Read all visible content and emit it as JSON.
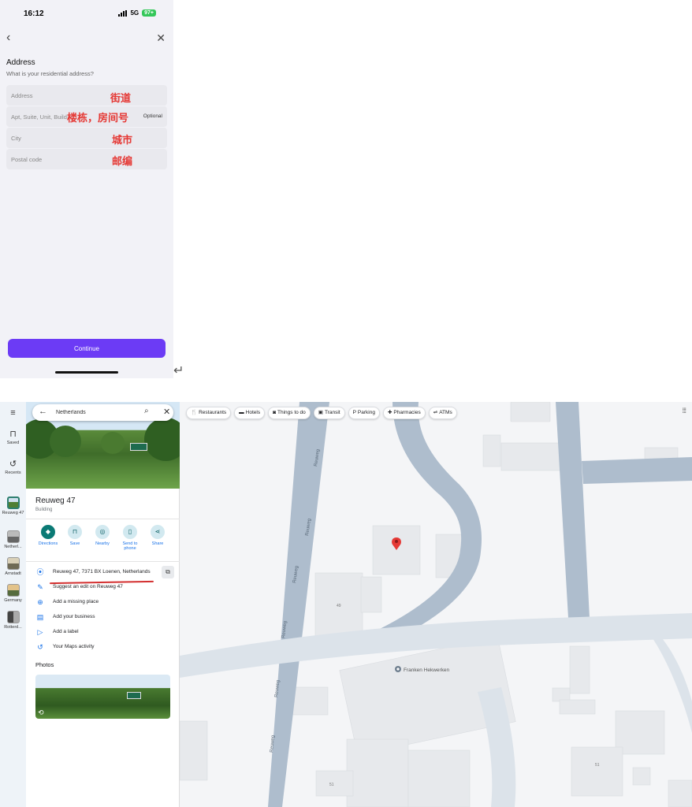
{
  "phone": {
    "status": {
      "time": "16:12",
      "network": "5G",
      "battery": "97+"
    },
    "form": {
      "title": "Address",
      "subtitle": "What is your residential address?",
      "fields": [
        {
          "placeholder": "Address",
          "annotation": "街道"
        },
        {
          "placeholder": "Apt, Suite, Unit, Building",
          "optional_label": "Optional",
          "annotation": "楼栋，房间号"
        },
        {
          "placeholder": "City",
          "annotation": "城市"
        },
        {
          "placeholder": "Postal code",
          "annotation": "邮编"
        }
      ],
      "continue_label": "Continue"
    },
    "return_glyph": "↵"
  },
  "maps": {
    "rail": [
      {
        "label": "Saved",
        "icon": "bookmark-icon"
      },
      {
        "label": "Recents",
        "icon": "history-icon"
      },
      {
        "label": "Reuweg 47"
      },
      {
        "label": "Netherl..."
      },
      {
        "label": "Arnstadt"
      },
      {
        "label": "Germany"
      },
      {
        "label": "Rotterd..."
      }
    ],
    "search": {
      "value": "Netherlands"
    },
    "place": {
      "title": "Reuweg 47",
      "type": "Building",
      "actions": [
        {
          "label": "Directions",
          "icon": "directions-icon"
        },
        {
          "label": "Save",
          "icon": "bookmark-icon"
        },
        {
          "label": "Nearby",
          "icon": "nearby-icon"
        },
        {
          "label": "Send to phone",
          "icon": "phone-icon"
        },
        {
          "label": "Share",
          "icon": "share-icon"
        }
      ],
      "address": "Reuweg 47, 7371 BX Loenen, Netherlands",
      "rows": [
        "Suggest an edit on Reuweg 47",
        "Add a missing place",
        "Add your business",
        "Add a label",
        "Your Maps activity"
      ],
      "photos_label": "Photos"
    },
    "chips": [
      "Restaurants",
      "Hotels",
      "Things to do",
      "Transit",
      "Parking",
      "Pharmacies",
      "ATMs"
    ],
    "map": {
      "road_label": "Reuweg",
      "poi": "Franken Hekwerken",
      "house_numbers": [
        "49",
        "51",
        "51"
      ],
      "colors": {
        "road": "#aebdcd",
        "road_light": "#dce3ea",
        "building": "#e7e9ec",
        "pin": "#e53935"
      }
    }
  }
}
